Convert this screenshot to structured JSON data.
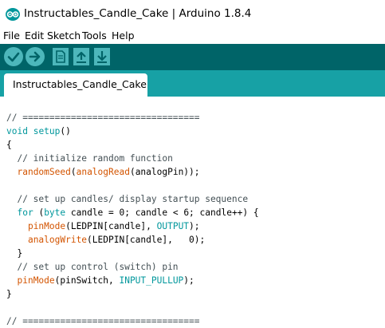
{
  "window": {
    "title": "Instructables_Candle_Cake | Arduino 1.8.4"
  },
  "menu": [
    "File",
    "Edit",
    "Sketch",
    "Tools",
    "Help"
  ],
  "toolbar": {
    "buttons": [
      "verify-icon",
      "upload-icon",
      "new-icon",
      "open-icon",
      "save-icon"
    ],
    "colors": {
      "bar": "#006468",
      "button": "#4db7bb",
      "tabbar": "#17a1a5"
    }
  },
  "tabs": [
    {
      "label": "Instructables_Candle_Cake",
      "active": true
    }
  ],
  "code_lines": [
    [
      {
        "t": "// =================================",
        "c": "comment"
      }
    ],
    [
      {
        "t": "void",
        "c": "kw"
      },
      {
        "t": " ",
        "c": "plain"
      },
      {
        "t": "setup",
        "c": "kw"
      },
      {
        "t": "()",
        "c": "plain"
      }
    ],
    [
      {
        "t": "{",
        "c": "plain"
      }
    ],
    [
      {
        "t": "  // initialize random function",
        "c": "comment"
      }
    ],
    [
      {
        "t": "  ",
        "c": "plain"
      },
      {
        "t": "randomSeed",
        "c": "fn"
      },
      {
        "t": "(",
        "c": "plain"
      },
      {
        "t": "analogRead",
        "c": "fn"
      },
      {
        "t": "(analogPin));",
        "c": "plain"
      }
    ],
    [
      {
        "t": "",
        "c": "plain"
      }
    ],
    [
      {
        "t": "  // set up candles/ display startup sequence",
        "c": "comment"
      }
    ],
    [
      {
        "t": "  ",
        "c": "plain"
      },
      {
        "t": "for",
        "c": "kw"
      },
      {
        "t": " (",
        "c": "plain"
      },
      {
        "t": "byte",
        "c": "kw"
      },
      {
        "t": " candle = 0; candle < 6; candle++) {",
        "c": "plain"
      }
    ],
    [
      {
        "t": "    ",
        "c": "plain"
      },
      {
        "t": "pinMode",
        "c": "fn"
      },
      {
        "t": "(LEDPIN[candle], ",
        "c": "plain"
      },
      {
        "t": "OUTPUT",
        "c": "const"
      },
      {
        "t": ");",
        "c": "plain"
      }
    ],
    [
      {
        "t": "    ",
        "c": "plain"
      },
      {
        "t": "analogWrite",
        "c": "fn"
      },
      {
        "t": "(LEDPIN[candle],   0);",
        "c": "plain"
      }
    ],
    [
      {
        "t": "  }",
        "c": "plain"
      }
    ],
    [
      {
        "t": "  // set up control (switch) pin",
        "c": "comment"
      }
    ],
    [
      {
        "t": "  ",
        "c": "plain"
      },
      {
        "t": "pinMode",
        "c": "fn"
      },
      {
        "t": "(pinSwitch, ",
        "c": "plain"
      },
      {
        "t": "INPUT_PULLUP",
        "c": "const"
      },
      {
        "t": ");",
        "c": "plain"
      }
    ],
    [
      {
        "t": "}",
        "c": "plain"
      }
    ],
    [
      {
        "t": "",
        "c": "plain"
      }
    ],
    [
      {
        "t": "// =================================",
        "c": "comment"
      }
    ]
  ]
}
